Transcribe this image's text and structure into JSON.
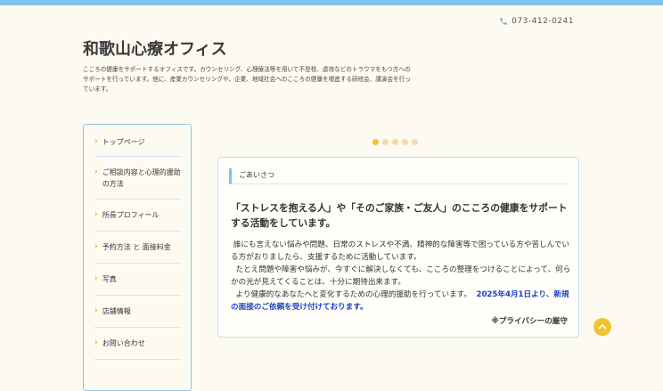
{
  "header": {
    "phone": "073-412-0241",
    "site_title": "和歌山心療オフィス",
    "site_description": "こころの健康をサポートするオフィスです。カウンセリング、心理療法等を用いて不登校、虐待などのトラウマをもつ方へのサポートを行っています。他に、産業カウンセリングや、企業、地域社会へのこころの健康を増進する研修会、講演会を行っています。"
  },
  "sidebar": {
    "items": [
      {
        "label": "トップページ"
      },
      {
        "label": "ご相談内容と心理的援助の方法"
      },
      {
        "label": "所長プロフィール"
      },
      {
        "label": "予約方法 と 面接料金"
      },
      {
        "label": "写真"
      },
      {
        "label": "店舗情報"
      },
      {
        "label": "お問い合わせ"
      }
    ]
  },
  "slider": {
    "count": 5,
    "active": 0
  },
  "greeting": {
    "heading": "ごあいさつ",
    "lead": "「ストレスを抱える人」や「そのご家族・ご友人」のこころの健康をサポートする活動をしています。",
    "p1": "誰にも言えない悩みや問題、日常のストレスや不満、精神的な障害等で困っている方や苦しんでいる方がおりましたら、支援するために活動しています。",
    "p2": "たとえ問題や障害や悩みが、今すぐに解決しなくても、こころの整理をつけることによって、何らかの光が見えてくることは、十分に期待出来ます。",
    "p3": "より健康的なあなたへと変化するための心理的援助を行っています。",
    "notice": "2025年4月1日より、新規の面接のご依頼を受け付けております。",
    "privacy": "※プライバシーの厳守"
  },
  "colors": {
    "accent_blue": "#7fc3ea",
    "accent_yellow": "#f1c232",
    "notice_blue": "#1a3fc2"
  },
  "icons": {
    "phone": "phone-icon",
    "chevron": "chevron-right-icon",
    "back_to_top": "chevron-up-icon"
  }
}
